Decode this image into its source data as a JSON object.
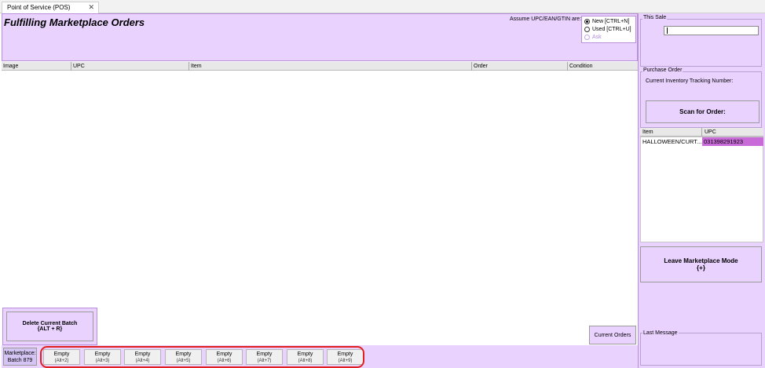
{
  "tab": {
    "label": "Point of Service (POS)",
    "close": "✕"
  },
  "header": {
    "title": "Fulfilling Marketplace Orders",
    "assume_label": "Assume UPC/EAN/GTIN are:",
    "options": [
      {
        "label": "New [CTRL+N]",
        "checked": true,
        "enabled": true
      },
      {
        "label": "Used [CTRL+U]",
        "checked": false,
        "enabled": true
      },
      {
        "label": "Ask",
        "checked": false,
        "enabled": false
      }
    ]
  },
  "table": {
    "columns": [
      "Image",
      "UPC",
      "Item",
      "Order",
      "Condition"
    ]
  },
  "delete_button": {
    "line1": "Delete Current Batch",
    "line2": "{ALT + R}"
  },
  "current_orders_button": "Current Orders",
  "batch": {
    "line1": "Marketplace:",
    "line2": "Batch 879"
  },
  "slots": [
    {
      "label": "Empty",
      "shortcut": "(Alt+2)"
    },
    {
      "label": "Empty",
      "shortcut": "(Alt+3)"
    },
    {
      "label": "Empty",
      "shortcut": "(Alt+4)"
    },
    {
      "label": "Empty",
      "shortcut": "(Alt+5)"
    },
    {
      "label": "Empty",
      "shortcut": "(Alt+6)"
    },
    {
      "label": "Empty",
      "shortcut": "(Alt+7)"
    },
    {
      "label": "Empty",
      "shortcut": "(Alt+8)"
    },
    {
      "label": "Empty",
      "shortcut": "(Alt+9)"
    }
  ],
  "right": {
    "this_sale_label": "This Sale",
    "this_sale_value": "",
    "purchase_order_label": "Purchase Order",
    "tracking_label": "Current Inventory Tracking Number:",
    "scan_button": "Scan for Order:",
    "po_columns": [
      "Item",
      "UPC"
    ],
    "po_rows": [
      {
        "item": "HALLOWEEN/CURT...",
        "upc": "031398291923"
      }
    ],
    "leave_button": {
      "line1": "Leave Marketplace Mode",
      "line2": "{+}"
    },
    "last_message_label": "Last Message"
  }
}
